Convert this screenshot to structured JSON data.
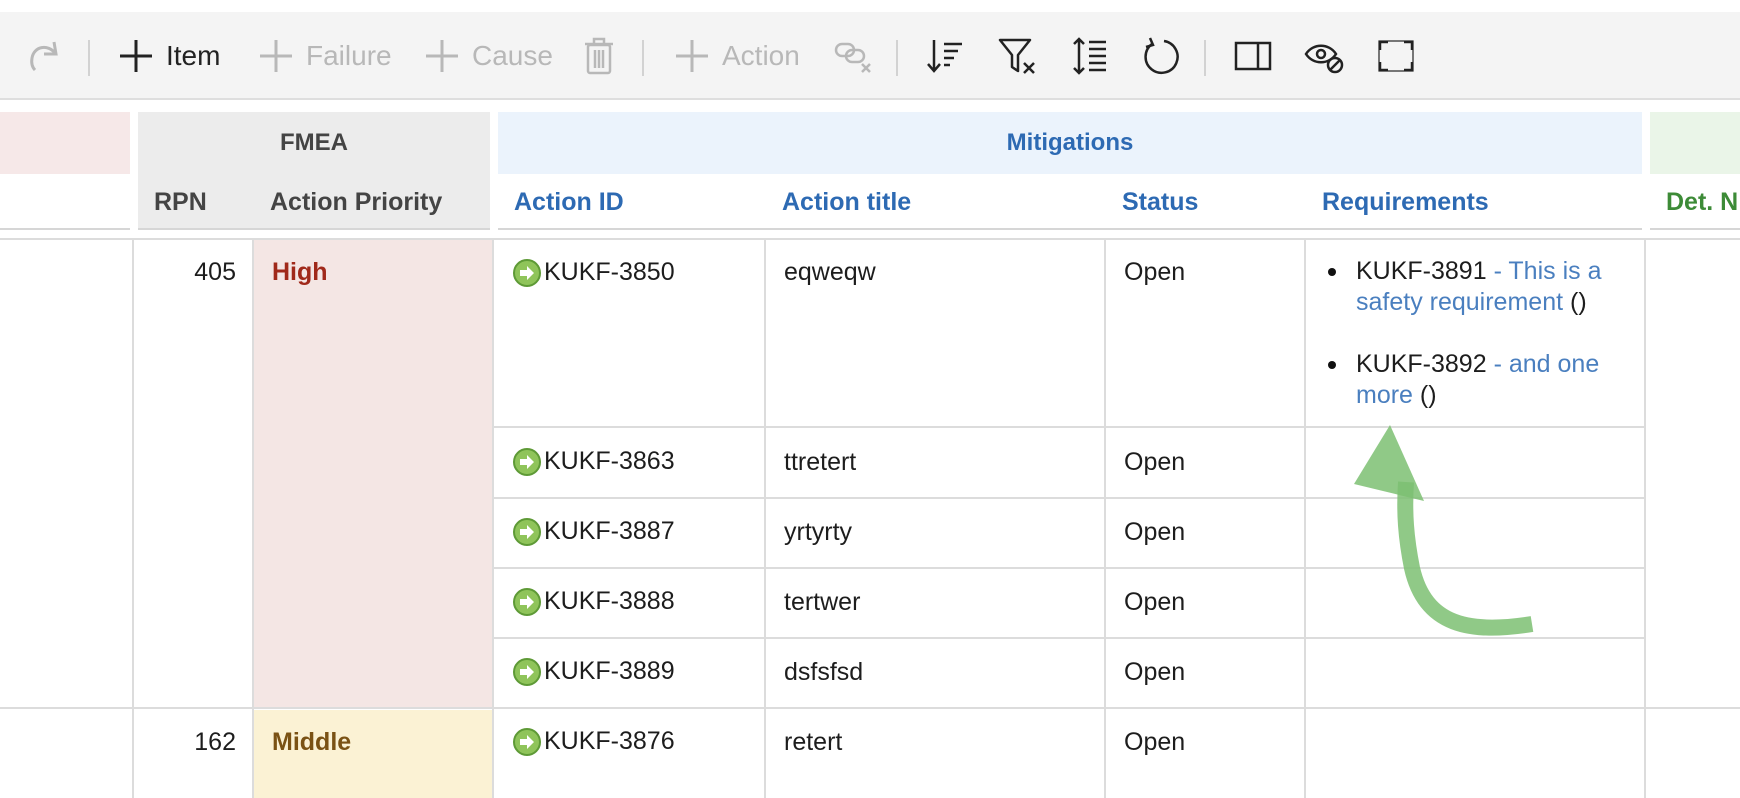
{
  "toolbar": {
    "item_label": "Item",
    "failure_label": "Failure",
    "cause_label": "Cause",
    "action_label": "Action"
  },
  "groups": {
    "fmea": "FMEA",
    "mitigations": "Mitigations"
  },
  "columns": {
    "rpn": "RPN",
    "action_priority": "Action Priority",
    "action_id": "Action ID",
    "action_title": "Action title",
    "status": "Status",
    "requirements": "Requirements",
    "det": "Det. N"
  },
  "rows": [
    {
      "rpn": "405",
      "priority": "High",
      "actions": [
        {
          "id": "KUKF-3850",
          "title": "eqweqw",
          "status": "Open",
          "requirements": [
            {
              "id": "KUKF-3891",
              "text": "- This is a safety requirement",
              "suffix": "()"
            },
            {
              "id": "KUKF-3892",
              "text": "- and one more",
              "suffix": "()"
            }
          ]
        },
        {
          "id": "KUKF-3863",
          "title": "ttretert",
          "status": "Open"
        },
        {
          "id": "KUKF-3887",
          "title": "yrtyrty",
          "status": "Open"
        },
        {
          "id": "KUKF-3888",
          "title": "tertwer",
          "status": "Open"
        },
        {
          "id": "KUKF-3889",
          "title": "dsfsfsd",
          "status": "Open"
        }
      ]
    },
    {
      "rpn": "162",
      "priority": "Middle",
      "actions": [
        {
          "id": "KUKF-3876",
          "title": "retert",
          "status": "Open"
        }
      ]
    }
  ],
  "colors": {
    "high_text": "#a0291a",
    "high_bg": "#f4e6e4",
    "middle_text": "#7a5214",
    "middle_bg": "#fbf2d4",
    "mitigations_bg": "#ebf3fc",
    "mitigations_text": "#2d6ab3",
    "fmea_bg": "#ececec",
    "det_text": "#3d8b37",
    "arrow": "#7cc072"
  }
}
